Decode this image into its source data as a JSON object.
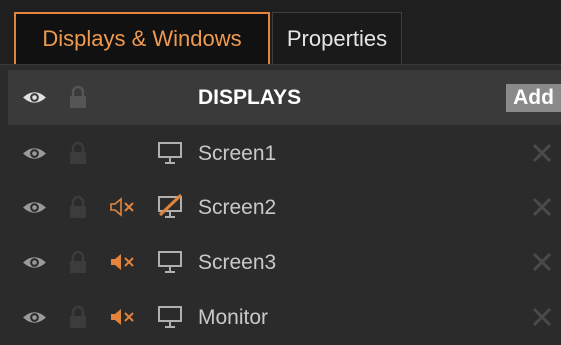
{
  "tabs": [
    {
      "label": "Displays & Windows",
      "active": true
    },
    {
      "label": "Properties",
      "active": false
    }
  ],
  "header": {
    "label": "DISPLAYS",
    "add_label": "Add"
  },
  "displays": [
    {
      "name": "Screen1",
      "icon": "monitor-icon",
      "muted": false
    },
    {
      "name": "Screen2",
      "icon": "monitor-warning-icon",
      "muted": true
    },
    {
      "name": "Screen3",
      "icon": "monitor-icon",
      "muted": true
    },
    {
      "name": "Monitor",
      "icon": "monitor-icon",
      "muted": true
    }
  ],
  "colors": {
    "accent": "#e3843d",
    "panel_bg": "#2b2b2b",
    "header_bg": "#3a3a3a",
    "text": "#c9c9c9",
    "icon_dim": "#3c3c3c"
  }
}
